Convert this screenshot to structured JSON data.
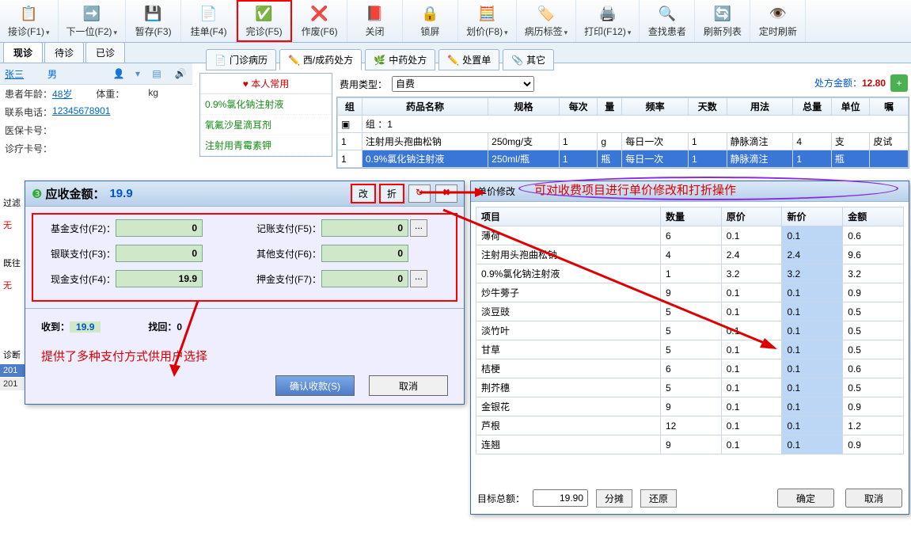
{
  "toolbar": [
    {
      "label": "接诊(F1)",
      "icon": "📋",
      "drop": true
    },
    {
      "label": "下一位(F2)",
      "icon": "➡️",
      "drop": true
    },
    {
      "label": "暂存(F3)",
      "icon": "💾"
    },
    {
      "label": "挂单(F4)",
      "icon": "📄"
    },
    {
      "label": "完诊(F5)",
      "icon": "✅",
      "hl": true
    },
    {
      "label": "作废(F6)",
      "icon": "❌"
    },
    {
      "label": "关闭",
      "icon": "📕"
    },
    {
      "label": "锁屏",
      "icon": "🔒"
    },
    {
      "label": "划价(F8)",
      "icon": "🧮",
      "drop": true
    },
    {
      "label": "病历标签",
      "icon": "🏷️",
      "drop": true
    },
    {
      "label": "打印(F12)",
      "icon": "🖨️",
      "drop": true
    },
    {
      "label": "查找患者",
      "icon": "🔍"
    },
    {
      "label": "刷新列表",
      "icon": "🔄"
    },
    {
      "label": "定时刷新",
      "icon": "👁️"
    }
  ],
  "main_tabs": [
    {
      "label": "现诊",
      "active": true
    },
    {
      "label": "待诊"
    },
    {
      "label": "已诊"
    }
  ],
  "sub_tabs": [
    {
      "label": "门诊病历",
      "icon": "📄"
    },
    {
      "label": "西/成药处方",
      "icon": "✏️",
      "active": true
    },
    {
      "label": "中药处方",
      "icon": "🌿"
    },
    {
      "label": "处置单",
      "icon": "✏️"
    },
    {
      "label": "其它",
      "icon": "📎"
    }
  ],
  "patient": {
    "name": "张三",
    "gender": "男",
    "age_label": "患者年龄：",
    "age": "48岁",
    "weight_label": "体重：",
    "weight_unit": "kg",
    "phone_label": "联系电话：",
    "phone": "12345678901",
    "card_label": "医保卡号：",
    "diag_label": "诊疗卡号："
  },
  "fav": {
    "title": "♥ 本人常用",
    "items": [
      "0.9%氯化钠注射液",
      "氧氟沙星滴耳剂",
      "注射用青霉素钾"
    ]
  },
  "fee": {
    "label": "费用类型：",
    "value": "自费",
    "amount_label": "处方金额：",
    "amount": "12.80"
  },
  "rx_headers": [
    "组",
    "药品名称",
    "规格",
    "每次",
    "量",
    "频率",
    "天数",
    "用法",
    "总量",
    "单位",
    "嘱"
  ],
  "rx_group": "组 ：1",
  "rx_rows": [
    {
      "n": "1",
      "name": "注射用头孢曲松钠",
      "spec": "250mg/支",
      "each": "1",
      "unit1": "g",
      "freq": "每日一次",
      "days": "1",
      "usage": "静脉滴注",
      "total": "4",
      "unit2": "支",
      "note": "皮试"
    },
    {
      "n": "1",
      "name": "0.9%氯化钠注射液",
      "spec": "250ml/瓶",
      "each": "1",
      "unit1": "瓶",
      "freq": "每日一次",
      "days": "1",
      "usage": "静脉滴注",
      "total": "1",
      "unit2": "瓶",
      "note": "",
      "sel": true
    }
  ],
  "pay": {
    "title": "应收金额：",
    "amount": "19.9",
    "btn_modify": "改",
    "btn_discount": "折",
    "fields": [
      {
        "label": "基金支付(F2)：",
        "val": "0"
      },
      {
        "label": "记账支付(F5)：",
        "val": "0",
        "dots": true
      },
      {
        "label": "银联支付(F3)：",
        "val": "0"
      },
      {
        "label": "其他支付(F6)：",
        "val": "0"
      },
      {
        "label": "现金支付(F4)：",
        "val": "19.9"
      },
      {
        "label": "押金支付(F7)：",
        "val": "0",
        "dots": true
      }
    ],
    "recv_label": "收到：",
    "recv": "19.9",
    "change_label": "找回：",
    "change": "0",
    "note": "提供了多种支付方式供用户选择",
    "confirm": "确认收款(S)",
    "cancel": "取消"
  },
  "price": {
    "title": "单价修改",
    "note": "可对收费项目进行单价修改和打折操作",
    "headers": [
      "项目",
      "数量",
      "原价",
      "新价",
      "金额"
    ],
    "rows": [
      {
        "name": "薄荷",
        "qty": "6",
        "old": "0.1",
        "newp": "0.1",
        "amt": "0.6"
      },
      {
        "name": "注射用头孢曲松钠",
        "qty": "4",
        "old": "2.4",
        "newp": "2.4",
        "amt": "9.6"
      },
      {
        "name": "0.9%氯化钠注射液",
        "qty": "1",
        "old": "3.2",
        "newp": "3.2",
        "amt": "3.2"
      },
      {
        "name": "炒牛蒡子",
        "qty": "9",
        "old": "0.1",
        "newp": "0.1",
        "amt": "0.9"
      },
      {
        "name": "淡豆豉",
        "qty": "5",
        "old": "0.1",
        "newp": "0.1",
        "amt": "0.5"
      },
      {
        "name": "淡竹叶",
        "qty": "5",
        "old": "0.1",
        "newp": "0.1",
        "amt": "0.5"
      },
      {
        "name": "甘草",
        "qty": "5",
        "old": "0.1",
        "newp": "0.1",
        "amt": "0.5"
      },
      {
        "name": "桔梗",
        "qty": "6",
        "old": "0.1",
        "newp": "0.1",
        "amt": "0.6"
      },
      {
        "name": "荆芥穗",
        "qty": "5",
        "old": "0.1",
        "newp": "0.1",
        "amt": "0.5"
      },
      {
        "name": "金银花",
        "qty": "9",
        "old": "0.1",
        "newp": "0.1",
        "amt": "0.9"
      },
      {
        "name": "芦根",
        "qty": "12",
        "old": "0.1",
        "newp": "0.1",
        "amt": "1.2"
      },
      {
        "name": "连翘",
        "qty": "9",
        "old": "0.1",
        "newp": "0.1",
        "amt": "0.9"
      }
    ],
    "target_label": "目标总额：",
    "target": "19.90",
    "btn_split": "分摊",
    "btn_restore": "还原",
    "btn_ok": "确定",
    "btn_cancel": "取消"
  },
  "side": {
    "filter": "过滤",
    "none": "无",
    "hist": "既往",
    "none2": "无",
    "diag": "诊断"
  },
  "hist": [
    "201",
    "201"
  ]
}
